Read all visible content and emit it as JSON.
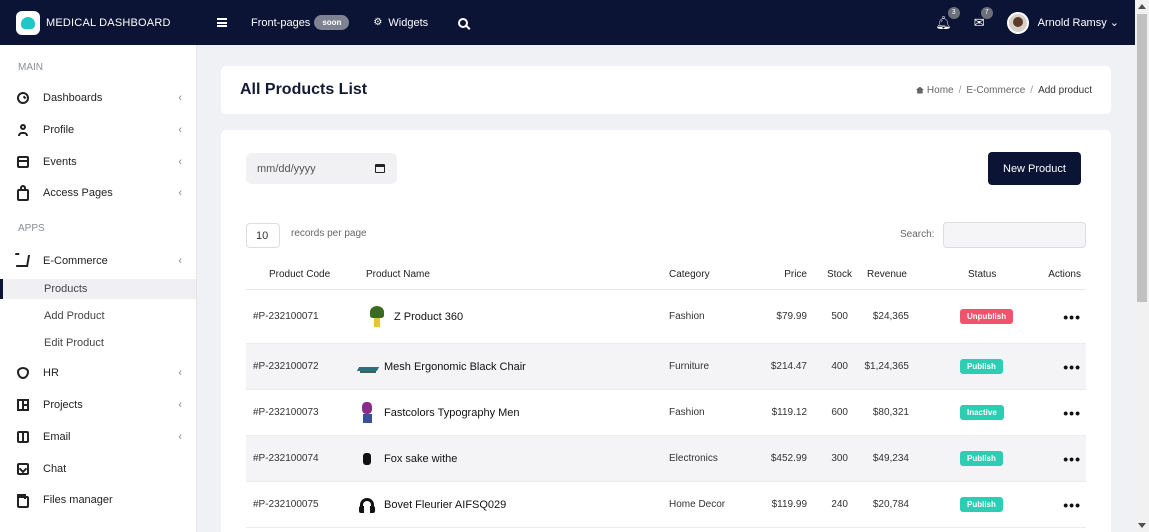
{
  "topbar": {
    "brand": "MEDICAL DASHBOARD",
    "frontpages_label": "Front-pages",
    "soon_badge": "soon",
    "widgets_label": "Widgets",
    "notifications_count": "3",
    "messages_count": "7",
    "user_name": "Arnold Ramsy"
  },
  "sidebar": {
    "section_main": "MAIN",
    "section_apps": "APPS",
    "items": [
      {
        "label": "Dashboards",
        "icon": "dashboard-icon"
      },
      {
        "label": "Profile",
        "icon": "user-icon"
      },
      {
        "label": "Events",
        "icon": "calendar-icon"
      },
      {
        "label": "Access Pages",
        "icon": "lock-icon"
      },
      {
        "label": "E-Commerce",
        "icon": "cart-icon"
      },
      {
        "label": "HR",
        "icon": "shield-icon"
      },
      {
        "label": "Projects",
        "icon": "grid-icon"
      },
      {
        "label": "Email",
        "icon": "book-icon"
      },
      {
        "label": "Chat",
        "icon": "chat-icon"
      },
      {
        "label": "Files manager",
        "icon": "folder-icon"
      }
    ],
    "ecommerce_sub": [
      "Products",
      "Add Product",
      "Edit Product"
    ],
    "active_sub": "Products"
  },
  "header": {
    "title": "All Products List",
    "breadcrumb": [
      "Home",
      "E-Commerce",
      "Add product"
    ]
  },
  "controls": {
    "date_placeholder": "mm/dd/yyyy",
    "new_product_label": "New Product",
    "records_value": "10",
    "records_label": "records per page",
    "search_label": "Search:"
  },
  "table": {
    "columns": [
      "Product Code",
      "Product Name",
      "Category",
      "Price",
      "Stock",
      "Revenue",
      "Status",
      "Actions"
    ],
    "rows": [
      {
        "code": "#P-232100071",
        "name": "Z Product 360",
        "thumb": "plant",
        "category": "Fashion",
        "price": "$79.99",
        "stock": "500",
        "revenue": "$24,365",
        "status": "Unpublish",
        "status_color": "#f0536b"
      },
      {
        "code": "#P-232100072",
        "name": "Mesh Ergonomic Black Chair",
        "thumb": "chair",
        "category": "Furniture",
        "price": "$214.47",
        "stock": "400",
        "revenue": "$1,24,365",
        "status": "Publish",
        "status_color": "#2ccdb2"
      },
      {
        "code": "#P-232100073",
        "name": "Fastcolors Typography Men",
        "thumb": "shirt",
        "category": "Fashion",
        "price": "$119.12",
        "stock": "600",
        "revenue": "$80,321",
        "status": "Inactive",
        "status_color": "#2ccdb2"
      },
      {
        "code": "#P-232100074",
        "name": "Fox sake withe",
        "thumb": "watch",
        "category": "Electronics",
        "price": "$452.99",
        "stock": "300",
        "revenue": "$49,234",
        "status": "Publish",
        "status_color": "#2ccdb2"
      },
      {
        "code": "#P-232100075",
        "name": "Bovet Fleurier AIFSQ029",
        "thumb": "headphone",
        "category": "Home Decor",
        "price": "$119.99",
        "stock": "240",
        "revenue": "$20,784",
        "status": "Publish",
        "status_color": "#2ccdb2"
      }
    ],
    "actions_glyph": "•••"
  }
}
